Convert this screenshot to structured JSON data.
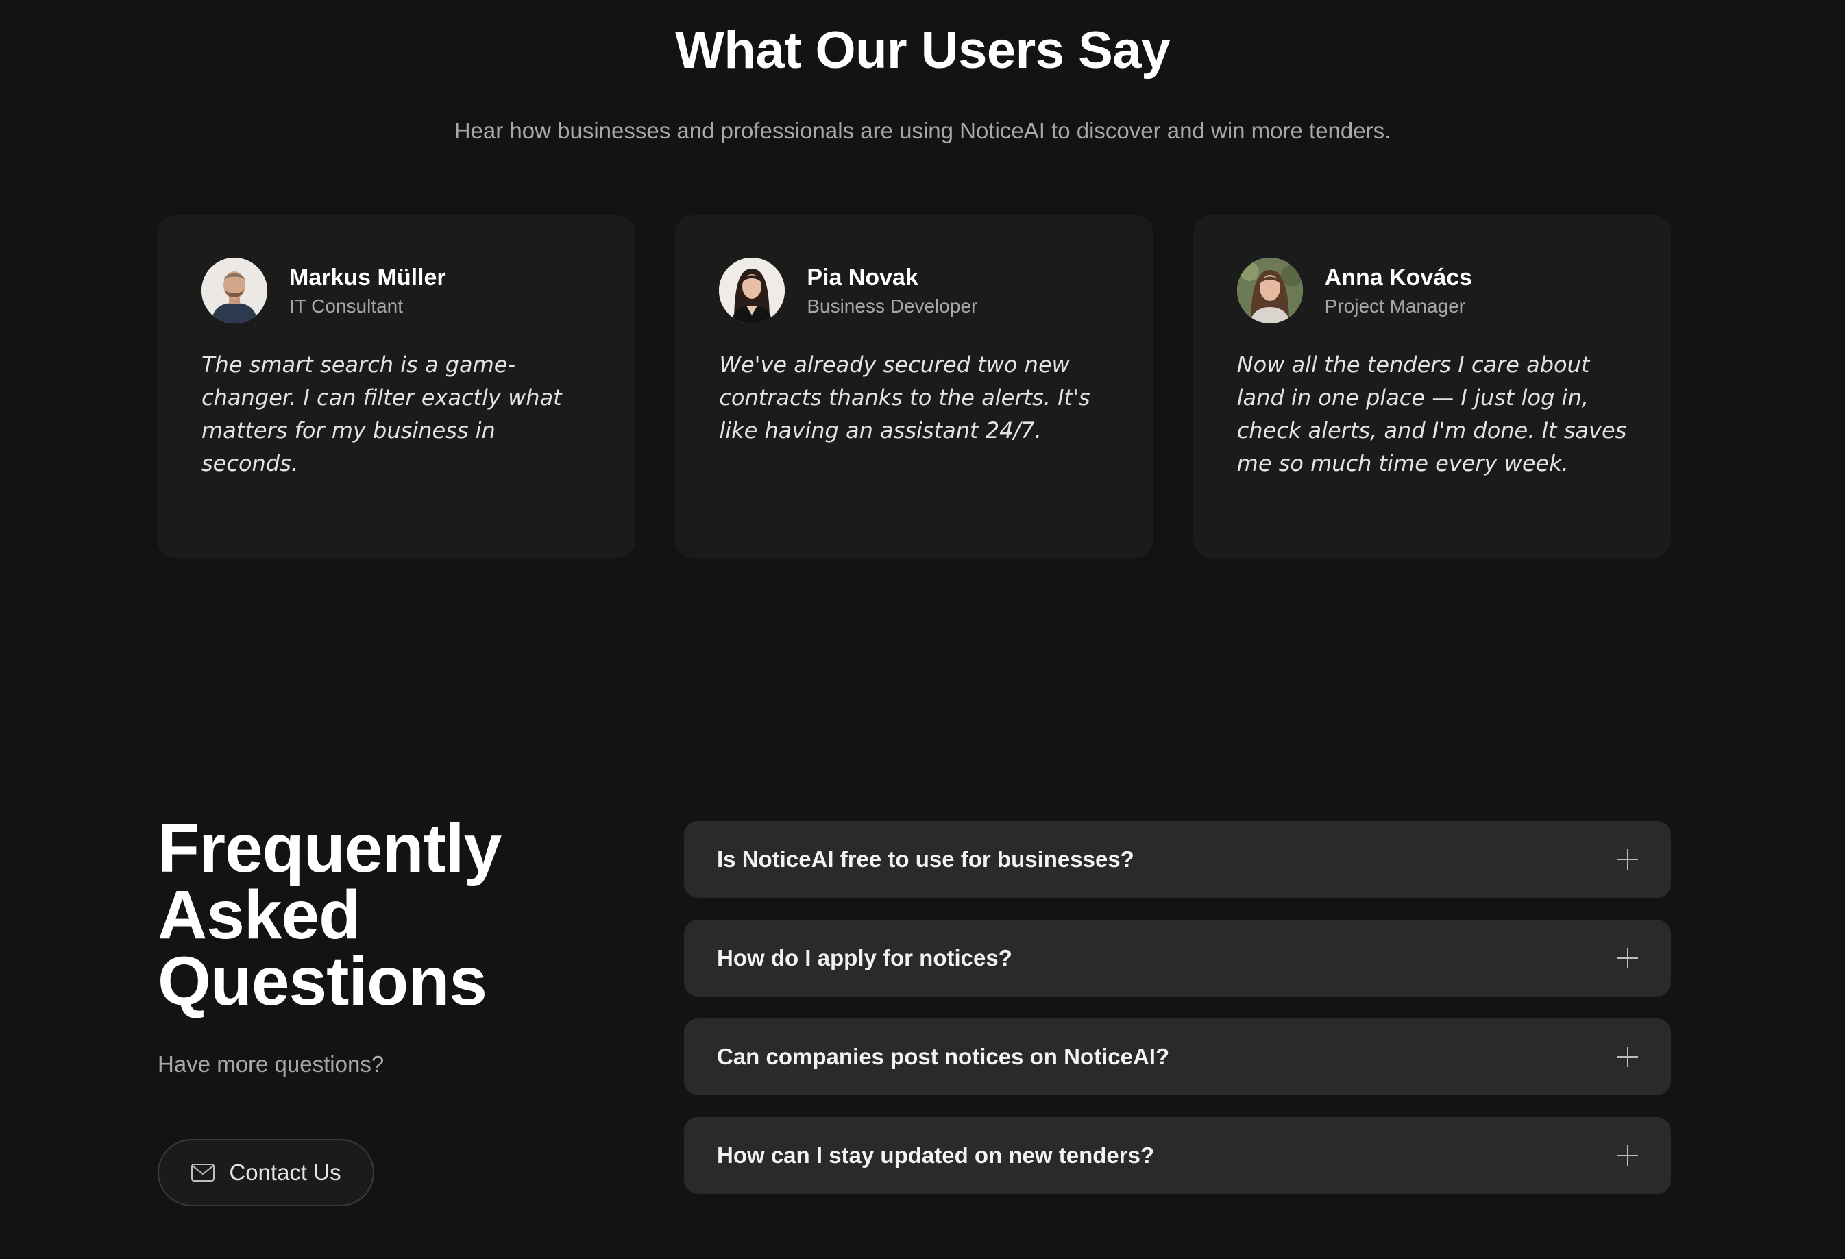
{
  "testimonials": {
    "title": "What Our Users Say",
    "subtitle": "Hear how businesses and professionals are using NoticeAI to discover and win more tenders.",
    "cards": [
      {
        "name": "Markus Müller",
        "role": "IT Consultant",
        "quote": "The smart search is a game-changer. I can filter exactly what matters for my business in seconds.",
        "avatar_icon": "avatar-man-beard"
      },
      {
        "name": "Pia Novak",
        "role": "Business Developer",
        "quote": "We've already secured two new contracts thanks to the alerts. It's like having an assistant 24/7.",
        "avatar_icon": "avatar-woman-dark-hair"
      },
      {
        "name": "Anna Kovács",
        "role": "Project Manager",
        "quote": "Now all the tenders I care about land in one place — I just log in, check alerts, and I'm done. It saves me so much time every week.",
        "avatar_icon": "avatar-woman-outdoor"
      }
    ]
  },
  "faq": {
    "title_lines": [
      "Frequently",
      "Asked",
      "Questions"
    ],
    "subtitle": "Have more questions?",
    "contact_label": "Contact Us",
    "contact_icon": "mail-icon",
    "items": [
      {
        "question": "Is NoticeAI free to use for businesses?",
        "icon": "plus-icon"
      },
      {
        "question": "How do I apply for notices?",
        "icon": "plus-icon"
      },
      {
        "question": "Can companies post notices on NoticeAI?",
        "icon": "plus-icon"
      },
      {
        "question": "How can I stay updated on new tenders?",
        "icon": "plus-icon"
      }
    ]
  },
  "colors": {
    "background": "#131313",
    "card": "#1b1b1b",
    "faq_item": "#2a2a2a",
    "muted_text": "#a8a8a8"
  }
}
